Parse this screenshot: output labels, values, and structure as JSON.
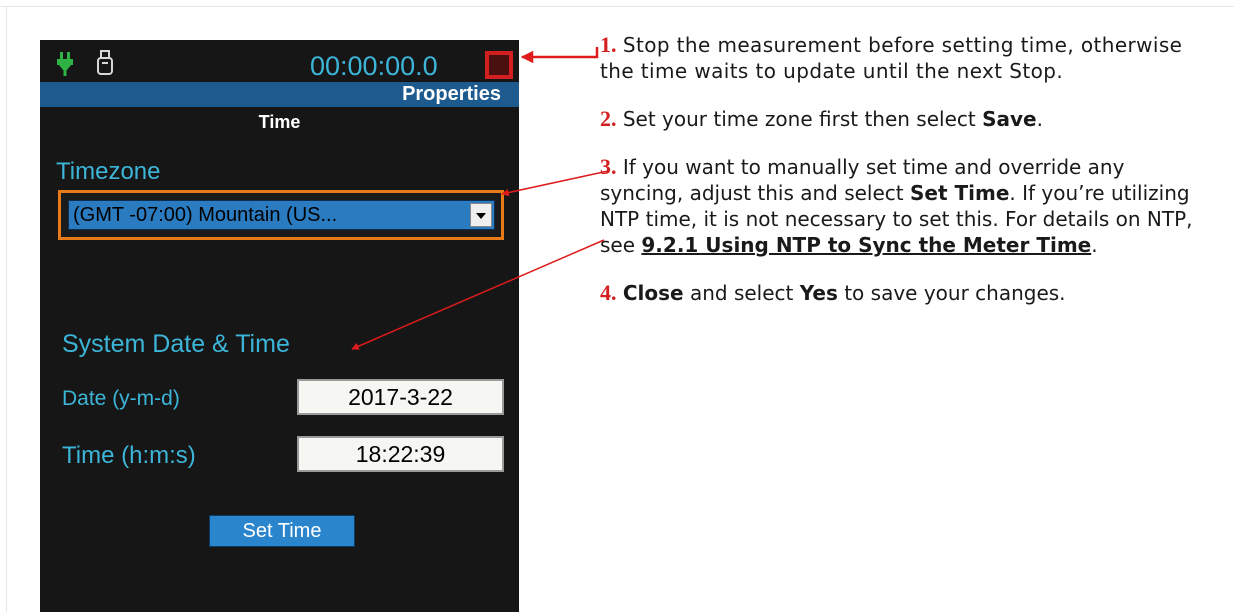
{
  "device": {
    "timer": "00:00:00.0",
    "properties_title": "Properties",
    "page_title": "Time",
    "timezone_label": "Timezone",
    "timezone_value": "(GMT -07:00) Mountain (US...",
    "system_section_label": "System Date & Time",
    "date_label": "Date (y-m-d)",
    "date_value": "2017-3-22",
    "time_label": "Time (h:m:s)",
    "time_value": "18:22:39",
    "set_time_button": "Set Time",
    "icons": [
      "power-plug-icon",
      "usb-icon",
      "stop-icon",
      "dropdown-arrow-icon"
    ],
    "colors": {
      "accent": "#3cb5d8",
      "titlebar": "#1d5a8e",
      "highlight": "#e87a17",
      "stop": "#d31f1f",
      "background": "#161616"
    }
  },
  "instructions": [
    {
      "number": "1.",
      "text": "Stop the measurement before setting time, otherwise the time waits to update until the next Stop."
    },
    {
      "number": "2.",
      "text_before": "Set your time zone first then select ",
      "bold": "Save",
      "text_after": "."
    },
    {
      "number": "3.",
      "text_before": "If you want to manually set time and override any syncing, adjust this and select ",
      "bold": "Set Time",
      "text_middle": ". If you’re utilizing NTP time, it is not necessary to set this. For details on NTP, see ",
      "link": "9.2.1 Using NTP to Sync the Meter Time",
      "text_after": "."
    },
    {
      "number": "4.",
      "bold_start": "Close",
      "text_middle": " and select ",
      "bold": "Yes",
      "text_after": " to save your changes."
    }
  ]
}
